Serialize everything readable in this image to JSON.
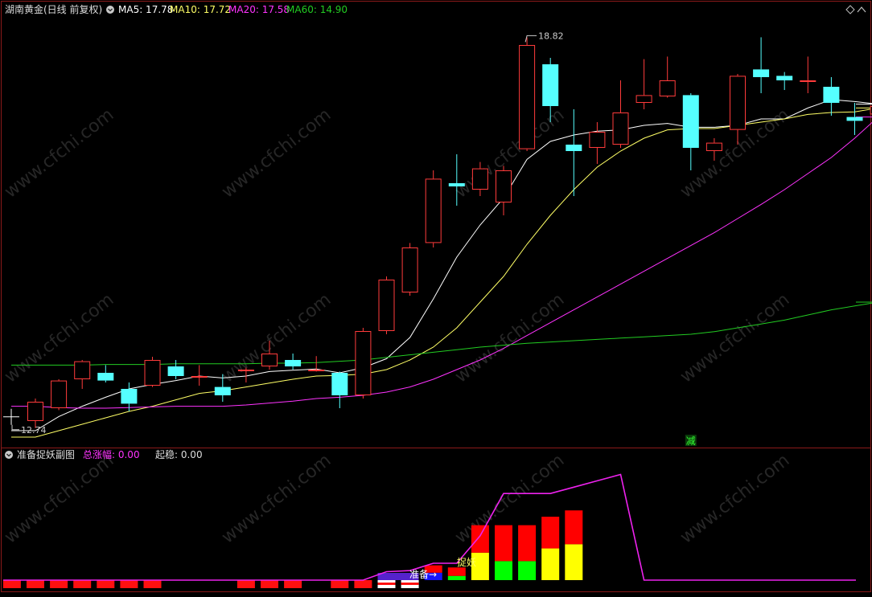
{
  "header": {
    "title": "湖南黄金(日线 前复权)",
    "ma5_label": "MA5: 17.78",
    "ma10_label": "MA10: 17.72",
    "ma20_label": "MA20: 17.58",
    "ma60_label": "MA60: 14.90"
  },
  "sub_header": {
    "title": "准备捉妖副图",
    "total_label": "总涨幅: 0.00",
    "stable_label": "起稳: 0.00"
  },
  "watermark": "www.cfchi.com",
  "colors": {
    "up": "#ff3b3b",
    "down": "#55ffff",
    "ma5": "#ffffff",
    "ma10": "#ffff66",
    "ma20": "#ff33ff",
    "ma60": "#22cc22",
    "border": "#8b1a1a"
  },
  "chart_data": [
    {
      "type": "candlestick",
      "title": "湖南黄金(日线 前复权)",
      "ylim": [
        12.5,
        19.1
      ],
      "annotations": {
        "high_label": "18.82",
        "low_label": "12.74",
        "sign_label": "减"
      },
      "candles": [
        {
          "o": 12.85,
          "h": 13.2,
          "l": 12.74,
          "c": 13.15
        },
        {
          "o": 13.05,
          "h": 13.5,
          "l": 13.02,
          "c": 13.48
        },
        {
          "o": 13.5,
          "h": 13.8,
          "l": 13.35,
          "c": 13.78
        },
        {
          "o": 13.6,
          "h": 13.72,
          "l": 13.45,
          "c": 13.48
        },
        {
          "o": 13.35,
          "h": 13.45,
          "l": 13.0,
          "c": 13.12
        },
        {
          "o": 13.4,
          "h": 13.85,
          "l": 13.38,
          "c": 13.8
        },
        {
          "o": 13.7,
          "h": 13.8,
          "l": 13.5,
          "c": 13.55
        },
        {
          "o": 13.55,
          "h": 13.72,
          "l": 13.4,
          "c": 13.55
        },
        {
          "o": 13.38,
          "h": 13.58,
          "l": 13.15,
          "c": 13.25
        },
        {
          "o": 13.65,
          "h": 13.68,
          "l": 13.45,
          "c": 13.65
        },
        {
          "o": 13.7,
          "h": 14.1,
          "l": 13.65,
          "c": 13.9
        },
        {
          "o": 13.8,
          "h": 13.9,
          "l": 13.65,
          "c": 13.7
        },
        {
          "o": 13.65,
          "h": 13.86,
          "l": 13.62,
          "c": 13.65
        },
        {
          "o": 13.6,
          "h": 13.62,
          "l": 13.05,
          "c": 13.25
        },
        {
          "o": 13.25,
          "h": 14.3,
          "l": 13.2,
          "c": 14.25
        },
        {
          "o": 14.25,
          "h": 15.1,
          "l": 14.2,
          "c": 15.05
        },
        {
          "o": 14.85,
          "h": 15.62,
          "l": 14.8,
          "c": 15.55
        },
        {
          "o": 15.62,
          "h": 16.75,
          "l": 15.55,
          "c": 16.62
        },
        {
          "o": 16.55,
          "h": 17.0,
          "l": 16.2,
          "c": 16.5
        },
        {
          "o": 16.45,
          "h": 16.88,
          "l": 16.35,
          "c": 16.78
        },
        {
          "o": 16.25,
          "h": 16.82,
          "l": 16.05,
          "c": 16.75
        },
        {
          "o": 17.08,
          "h": 18.82,
          "l": 17.05,
          "c": 18.7
        },
        {
          "o": 18.4,
          "h": 18.5,
          "l": 17.5,
          "c": 17.75
        },
        {
          "o": 17.15,
          "h": 17.7,
          "l": 16.35,
          "c": 17.05
        },
        {
          "o": 17.1,
          "h": 17.5,
          "l": 16.85,
          "c": 17.35
        },
        {
          "o": 17.15,
          "h": 18.15,
          "l": 17.1,
          "c": 17.65
        },
        {
          "o": 17.8,
          "h": 18.48,
          "l": 17.7,
          "c": 17.92
        },
        {
          "o": 17.9,
          "h": 18.52,
          "l": 17.88,
          "c": 18.15
        },
        {
          "o": 17.92,
          "h": 17.95,
          "l": 16.75,
          "c": 17.1
        },
        {
          "o": 17.05,
          "h": 17.25,
          "l": 16.9,
          "c": 17.18
        },
        {
          "o": 17.38,
          "h": 18.25,
          "l": 17.15,
          "c": 18.22
        },
        {
          "o": 18.32,
          "h": 18.82,
          "l": 17.95,
          "c": 18.2
        },
        {
          "o": 18.22,
          "h": 18.28,
          "l": 18.0,
          "c": 18.15
        },
        {
          "o": 18.15,
          "h": 18.52,
          "l": 17.95,
          "c": 18.15
        },
        {
          "o": 18.05,
          "h": 18.2,
          "l": 17.6,
          "c": 17.8
        },
        {
          "o": 17.58,
          "h": 17.8,
          "l": 17.3,
          "c": 17.52
        },
        {
          "o": 17.62,
          "h": 17.85,
          "l": 17.45,
          "c": 17.75
        }
      ],
      "series": [
        {
          "name": "MA5",
          "values": [
            12.7,
            12.92,
            13.08,
            13.22,
            13.35,
            13.42,
            13.48,
            13.55,
            13.52,
            13.55,
            13.62,
            13.64,
            13.66,
            13.6,
            13.68,
            13.82,
            14.15,
            14.75,
            15.4,
            15.9,
            16.32,
            16.92,
            17.2,
            17.3,
            17.36,
            17.38,
            17.45,
            17.48,
            17.42,
            17.42,
            17.45,
            17.55,
            17.55,
            17.72,
            17.85,
            17.82,
            17.78
          ]
        },
        {
          "name": "MA10",
          "values": [
            12.6,
            12.7,
            12.8,
            12.9,
            13.0,
            13.08,
            13.18,
            13.28,
            13.32,
            13.38,
            13.44,
            13.5,
            13.55,
            13.56,
            13.58,
            13.65,
            13.8,
            14.0,
            14.3,
            14.7,
            15.1,
            15.6,
            16.05,
            16.45,
            16.8,
            17.05,
            17.25,
            17.38,
            17.4,
            17.4,
            17.45,
            17.5,
            17.55,
            17.62,
            17.65,
            17.66,
            17.72
          ]
        },
        {
          "name": "MA20",
          "values": [
            13.08,
            13.06,
            13.05,
            13.05,
            13.06,
            13.07,
            13.08,
            13.08,
            13.08,
            13.1,
            13.13,
            13.16,
            13.2,
            13.22,
            13.25,
            13.3,
            13.38,
            13.5,
            13.65,
            13.8,
            13.98,
            14.18,
            14.38,
            14.58,
            14.78,
            14.98,
            15.18,
            15.38,
            15.58,
            15.78,
            16.0,
            16.22,
            16.45,
            16.7,
            16.95,
            17.25,
            17.58
          ]
        },
        {
          "name": "MA60",
          "values": [
            13.72,
            13.72,
            13.72,
            13.73,
            13.73,
            13.73,
            13.74,
            13.74,
            13.74,
            13.74,
            13.75,
            13.75,
            13.76,
            13.78,
            13.8,
            13.84,
            13.88,
            13.92,
            13.96,
            14.0,
            14.03,
            14.06,
            14.08,
            14.1,
            14.12,
            14.14,
            14.16,
            14.18,
            14.2,
            14.24,
            14.3,
            14.36,
            14.42,
            14.5,
            14.58,
            14.64,
            14.7
          ]
        }
      ]
    },
    {
      "type": "bar",
      "title": "准备捉妖副图",
      "labels": {
        "prepare": "准备→",
        "catch": "捉妖"
      },
      "line_values": [
        0,
        0,
        0,
        0,
        0,
        0,
        0,
        0,
        0,
        0,
        0,
        0,
        0,
        0,
        0,
        0,
        0.4,
        0.45,
        0.8,
        0.8,
        2.1,
        4.1,
        4.1,
        4.1,
        4.4,
        4.7,
        5.0,
        0,
        0,
        0,
        0,
        0,
        0,
        0,
        0,
        0,
        0
      ],
      "bar_groups": [
        {
          "name": "red_base",
          "values": [
            1,
            1,
            1,
            1,
            1,
            1,
            1,
            0,
            0,
            0,
            1,
            1,
            1,
            0,
            1,
            1,
            1,
            0,
            0,
            0,
            0,
            0,
            0,
            0,
            0,
            0,
            0,
            0,
            0,
            0,
            0,
            0,
            0,
            0,
            0,
            0,
            0
          ]
        },
        {
          "name": "white_base",
          "values": [
            0,
            0,
            0,
            0,
            0,
            0,
            0,
            0,
            0,
            0,
            0,
            0,
            0,
            0,
            0,
            0,
            1,
            1,
            0,
            0,
            0,
            0,
            0,
            0,
            0,
            0,
            0,
            0,
            0,
            0,
            0,
            0,
            0,
            0,
            0,
            0,
            0
          ]
        },
        {
          "name": "stack",
          "values": [
            null,
            null,
            null,
            null,
            null,
            null,
            null,
            null,
            null,
            null,
            null,
            null,
            null,
            null,
            null,
            null,
            null,
            null,
            {
              "blue": 0.35,
              "red": 0.35
            },
            {
              "green": 0.2,
              "red": 0.4
            },
            {
              "yellow": 1.3,
              "red": 1.3
            },
            {
              "green": 0.9,
              "red": 1.7
            },
            {
              "green": 0.9,
              "red": 1.7
            },
            {
              "yellow": 1.5,
              "red": 1.5
            },
            {
              "yellow": 1.7,
              "red": 1.6
            },
            null,
            null,
            null,
            null,
            null,
            null,
            null,
            null,
            null,
            null,
            null,
            null
          ]
        }
      ]
    }
  ]
}
